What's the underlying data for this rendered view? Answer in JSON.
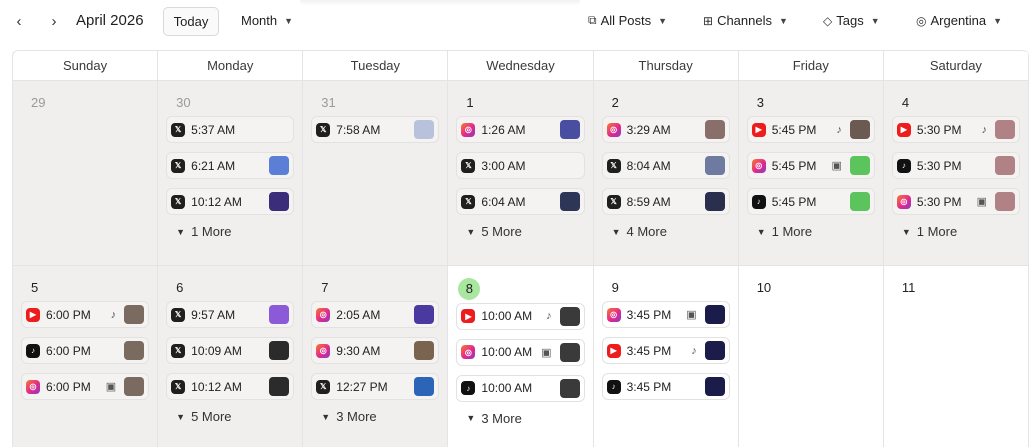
{
  "toolbar": {
    "prev": "‹",
    "next": "›",
    "month": "April 2026",
    "today": "Today",
    "view": "Month",
    "posts_filter": "All Posts",
    "channels": "Channels",
    "tags": "Tags",
    "region": "Argentina"
  },
  "weekdays": [
    "Sunday",
    "Monday",
    "Tuesday",
    "Wednesday",
    "Thursday",
    "Friday",
    "Saturday"
  ],
  "weeks": [
    [
      {
        "day": "29",
        "posts": []
      },
      {
        "day": "30",
        "posts": [
          {
            "net": "x",
            "time": "5:37 AM",
            "fmt": "",
            "thumb": ""
          },
          {
            "net": "x",
            "time": "6:21 AM",
            "fmt": "",
            "thumb": "#5b7fd6"
          },
          {
            "net": "x",
            "time": "10:12 AM",
            "fmt": "",
            "thumb": "#3c2d7a"
          }
        ],
        "more": "1 More"
      },
      {
        "day": "31",
        "posts": [
          {
            "net": "x",
            "time": "7:58 AM",
            "fmt": "",
            "thumb": "#b8c2dc"
          }
        ]
      },
      {
        "day": "1",
        "posts": [
          {
            "net": "ig",
            "time": "1:26 AM",
            "fmt": "",
            "thumb": "#4a4ea0"
          },
          {
            "net": "x",
            "time": "3:00 AM",
            "fmt": "",
            "thumb": ""
          },
          {
            "net": "x",
            "time": "6:04 AM",
            "fmt": "",
            "thumb": "#2e3658"
          }
        ],
        "more": "5 More"
      },
      {
        "day": "2",
        "posts": [
          {
            "net": "ig",
            "time": "3:29 AM",
            "fmt": "",
            "thumb": "#8a6e6a"
          },
          {
            "net": "x",
            "time": "8:04 AM",
            "fmt": "",
            "thumb": "#6f7aa0"
          },
          {
            "net": "x",
            "time": "8:59 AM",
            "fmt": "",
            "thumb": "#2a2f4e"
          }
        ],
        "more": "4 More"
      },
      {
        "day": "3",
        "posts": [
          {
            "net": "yt",
            "time": "5:45 PM",
            "fmt": "shorts",
            "thumb": "#6b5a52"
          },
          {
            "net": "ig",
            "time": "5:45 PM",
            "fmt": "reel",
            "thumb": "#5cc45c"
          },
          {
            "net": "tt",
            "time": "5:45 PM",
            "fmt": "",
            "thumb": "#5cc45c"
          }
        ],
        "more": "1 More"
      },
      {
        "day": "4",
        "posts": [
          {
            "net": "yt",
            "time": "5:30 PM",
            "fmt": "shorts",
            "thumb": "#b08286"
          },
          {
            "net": "tt",
            "time": "5:30 PM",
            "fmt": "",
            "thumb": "#b08286"
          },
          {
            "net": "ig",
            "time": "5:30 PM",
            "fmt": "reel",
            "thumb": "#b08286"
          }
        ],
        "more": "1 More"
      }
    ],
    [
      {
        "day": "5",
        "posts": [
          {
            "net": "yt",
            "time": "6:00 PM",
            "fmt": "shorts",
            "thumb": "#7a6a60"
          },
          {
            "net": "tt",
            "time": "6:00 PM",
            "fmt": "",
            "thumb": "#7a6a60"
          },
          {
            "net": "ig",
            "time": "6:00 PM",
            "fmt": "reel",
            "thumb": "#7a6a60"
          }
        ]
      },
      {
        "day": "6",
        "posts": [
          {
            "net": "x",
            "time": "9:57 AM",
            "fmt": "",
            "thumb": "#8a5ad8"
          },
          {
            "net": "x",
            "time": "10:09 AM",
            "fmt": "",
            "thumb": "#2b2b2b"
          },
          {
            "net": "x",
            "time": "10:12 AM",
            "fmt": "",
            "thumb": "#2b2b2b"
          }
        ],
        "more": "5 More"
      },
      {
        "day": "7",
        "posts": [
          {
            "net": "ig",
            "time": "2:05 AM",
            "fmt": "",
            "thumb": "#4a3aa0"
          },
          {
            "net": "ig",
            "time": "9:30 AM",
            "fmt": "",
            "thumb": "#7a6450"
          },
          {
            "net": "x",
            "time": "12:27 PM",
            "fmt": "",
            "thumb": "#2c64b8"
          }
        ],
        "more": "3 More"
      },
      {
        "day": "8",
        "today": true,
        "posts": [
          {
            "net": "yt",
            "time": "10:00 AM",
            "fmt": "shorts",
            "thumb": "#3a3a3a"
          },
          {
            "net": "ig",
            "time": "10:00 AM",
            "fmt": "reel",
            "thumb": "#3a3a3a"
          },
          {
            "net": "tt",
            "time": "10:00 AM",
            "fmt": "",
            "thumb": "#3a3a3a"
          }
        ],
        "more": "3 More"
      },
      {
        "day": "9",
        "posts": [
          {
            "net": "ig",
            "time": "3:45 PM",
            "fmt": "reel",
            "thumb": "#1c1c4a"
          },
          {
            "net": "yt",
            "time": "3:45 PM",
            "fmt": "shorts",
            "thumb": "#1c1c4a"
          },
          {
            "net": "tt",
            "time": "3:45 PM",
            "fmt": "",
            "thumb": "#1c1c4a"
          }
        ]
      },
      {
        "day": "10",
        "posts": []
      },
      {
        "day": "11",
        "posts": []
      }
    ]
  ],
  "icons": {
    "prev": "chevron-left-icon",
    "next": "chevron-right-icon",
    "posts": "copy-icon",
    "channels": "grid-icon",
    "tags": "tag-icon",
    "region": "globe-icon"
  }
}
